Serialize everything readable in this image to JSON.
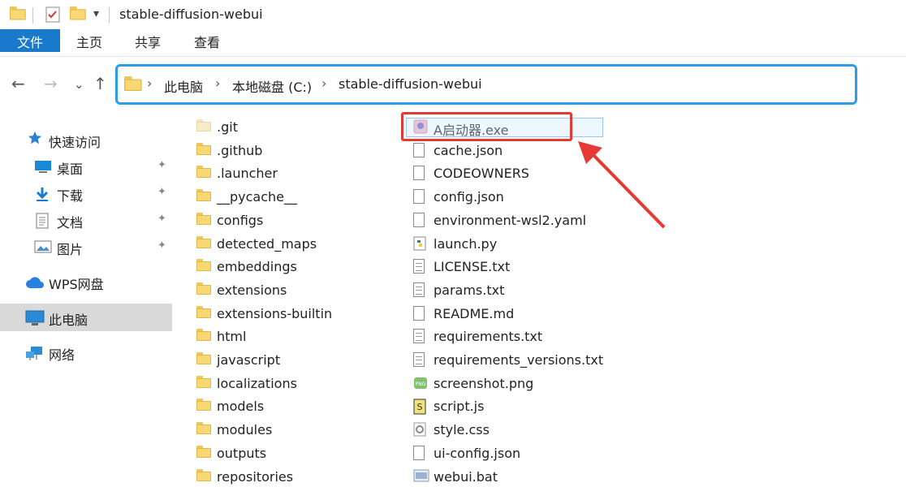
{
  "window": {
    "title": "stable-diffusion-webui",
    "quick_access_dropdown": "▾"
  },
  "ribbon": {
    "tabs": [
      "文件",
      "主页",
      "共享",
      "查看"
    ]
  },
  "nav": {
    "back": "←",
    "forward": "→",
    "recent": "⌄",
    "up": "↑",
    "breadcrumbs": [
      "此电脑",
      "本地磁盘 (C:)",
      "stable-diffusion-webui"
    ],
    "separator": "›"
  },
  "sidebar": {
    "quick_access": "快速访问",
    "items": [
      {
        "label": "桌面",
        "icon": "desktop-icon"
      },
      {
        "label": "下载",
        "icon": "download-icon"
      },
      {
        "label": "文档",
        "icon": "documents-icon"
      },
      {
        "label": "图片",
        "icon": "pictures-icon"
      }
    ],
    "wps": "WPS网盘",
    "this_pc": "此电脑",
    "network": "网络",
    "pin_glyph": "📌"
  },
  "folders": [
    ".git",
    ".github",
    ".launcher",
    "__pycache__",
    "configs",
    "detected_maps",
    "embeddings",
    "extensions",
    "extensions-builtin",
    "html",
    "javascript",
    "localizations",
    "models",
    "modules",
    "outputs",
    "repositories"
  ],
  "files": [
    {
      "name": "A启动器.exe",
      "icon": "exe-icon"
    },
    {
      "name": "cache.json",
      "icon": "file-icon"
    },
    {
      "name": "CODEOWNERS",
      "icon": "file-icon"
    },
    {
      "name": "config.json",
      "icon": "file-icon"
    },
    {
      "name": "environment-wsl2.yaml",
      "icon": "file-icon"
    },
    {
      "name": "launch.py",
      "icon": "python-icon"
    },
    {
      "name": "LICENSE.txt",
      "icon": "text-file-icon"
    },
    {
      "name": "params.txt",
      "icon": "text-file-icon"
    },
    {
      "name": "README.md",
      "icon": "file-icon"
    },
    {
      "name": "requirements.txt",
      "icon": "text-file-icon"
    },
    {
      "name": "requirements_versions.txt",
      "icon": "text-file-icon"
    },
    {
      "name": "screenshot.png",
      "icon": "png-icon"
    },
    {
      "name": "script.js",
      "icon": "js-icon"
    },
    {
      "name": "style.css",
      "icon": "css-icon"
    },
    {
      "name": "ui-config.json",
      "icon": "file-icon"
    },
    {
      "name": "webui.bat",
      "icon": "bat-icon"
    }
  ],
  "colors": {
    "accent": "#1979ca",
    "address_border": "#2b9fe6",
    "highlight": "#e53935",
    "folder": "#f8d775"
  }
}
